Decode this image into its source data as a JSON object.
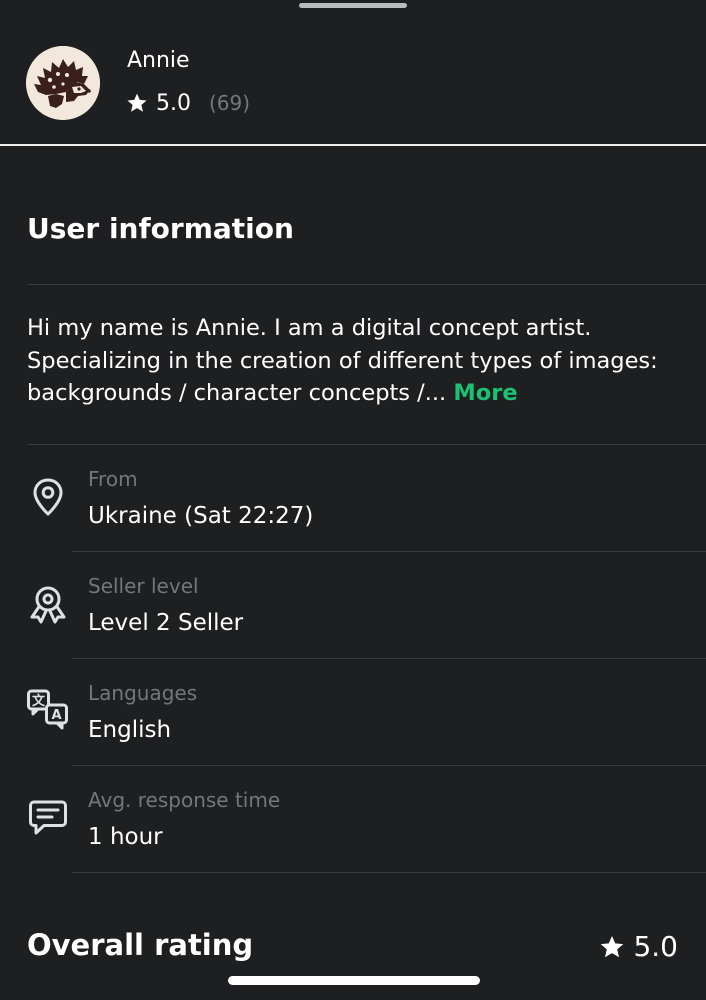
{
  "seller": {
    "name": "Annie",
    "rating": "5.0",
    "review_count": "(69)"
  },
  "user_info": {
    "title": "User information",
    "description": "Hi my name is Annie. I am a digital concept artist. Specializing in the creation of different types of images: backgrounds / character concepts /...",
    "more_label": "More",
    "rows": [
      {
        "label": "From",
        "value": "Ukraine (Sat 22:27)",
        "icon": "location-pin-icon"
      },
      {
        "label": "Seller level",
        "value": "Level 2 Seller",
        "icon": "award-badge-icon"
      },
      {
        "label": "Languages",
        "value": "English",
        "icon": "translate-icon"
      },
      {
        "label": "Avg. response time",
        "value": "1 hour",
        "icon": "chat-bubble-icon"
      }
    ]
  },
  "overall": {
    "title": "Overall rating",
    "rating": "5.0"
  },
  "colors": {
    "background": "#1e1f21",
    "accent": "#1dbf73",
    "muted_text": "#74767a"
  }
}
